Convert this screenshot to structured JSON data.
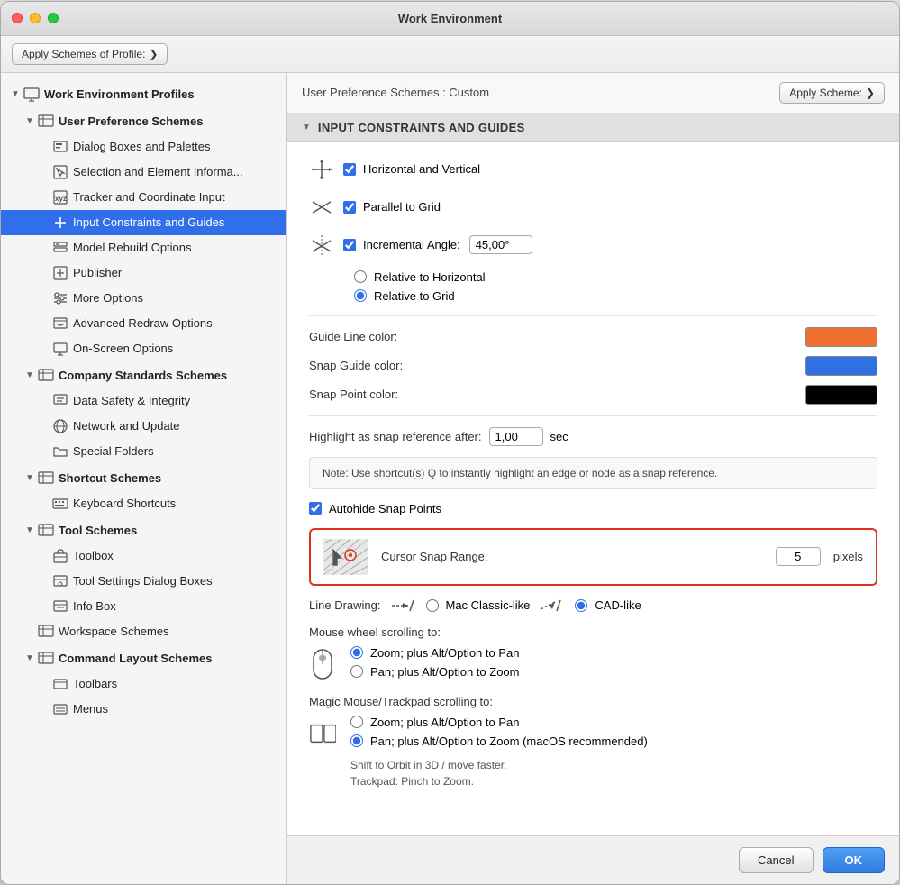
{
  "window": {
    "title": "Work Environment"
  },
  "toolbar": {
    "apply_schemes_label": "Apply Schemes of Profile:",
    "apply_schemes_chevron": "❯"
  },
  "content_header": {
    "title": "User Preference Schemes :  Custom",
    "apply_scheme_label": "Apply Scheme:",
    "apply_scheme_chevron": "❯"
  },
  "sidebar": {
    "items": [
      {
        "id": "work-env-profiles",
        "label": "Work Environment Profiles",
        "level": 0,
        "hasArrow": true,
        "arrowState": "down",
        "iconType": "monitor"
      },
      {
        "id": "user-pref-schemes",
        "label": "User Preference Schemes",
        "level": 1,
        "hasArrow": true,
        "arrowState": "down",
        "iconType": "person-grid"
      },
      {
        "id": "dialog-boxes",
        "label": "Dialog Boxes and Palettes",
        "level": 2,
        "hasArrow": false,
        "iconType": "dialog"
      },
      {
        "id": "selection-element",
        "label": "Selection and Element Informa...",
        "level": 2,
        "hasArrow": false,
        "iconType": "cursor"
      },
      {
        "id": "tracker-coord",
        "label": "Tracker and Coordinate Input",
        "level": 2,
        "hasArrow": false,
        "iconType": "xyz"
      },
      {
        "id": "input-constraints",
        "label": "Input Constraints and Guides",
        "level": 2,
        "hasArrow": false,
        "iconType": "constraint",
        "active": true
      },
      {
        "id": "model-rebuild",
        "label": "Model Rebuild Options",
        "level": 2,
        "hasArrow": false,
        "iconType": "rebuild"
      },
      {
        "id": "publisher",
        "label": "Publisher",
        "level": 2,
        "hasArrow": false,
        "iconType": "publish"
      },
      {
        "id": "more-options",
        "label": "More Options",
        "level": 2,
        "hasArrow": false,
        "iconType": "sliders"
      },
      {
        "id": "advanced-redraw",
        "label": "Advanced Redraw Options",
        "level": 2,
        "hasArrow": false,
        "iconType": "redraw"
      },
      {
        "id": "on-screen",
        "label": "On-Screen Options",
        "level": 2,
        "hasArrow": false,
        "iconType": "screen"
      },
      {
        "id": "company-standards",
        "label": "Company Standards Schemes",
        "level": 1,
        "hasArrow": true,
        "arrowState": "down",
        "iconType": "company"
      },
      {
        "id": "data-safety",
        "label": "Data Safety & Integrity",
        "level": 2,
        "hasArrow": false,
        "iconType": "shield"
      },
      {
        "id": "network-update",
        "label": "Network and Update",
        "level": 2,
        "hasArrow": false,
        "iconType": "network"
      },
      {
        "id": "special-folders",
        "label": "Special Folders",
        "level": 2,
        "hasArrow": false,
        "iconType": "folder"
      },
      {
        "id": "shortcut-schemes",
        "label": "Shortcut Schemes",
        "level": 1,
        "hasArrow": true,
        "arrowState": "down",
        "iconType": "shortcut"
      },
      {
        "id": "keyboard-shortcuts",
        "label": "Keyboard Shortcuts",
        "level": 2,
        "hasArrow": false,
        "iconType": "keyboard"
      },
      {
        "id": "tool-schemes",
        "label": "Tool Schemes",
        "level": 1,
        "hasArrow": true,
        "arrowState": "down",
        "iconType": "tool"
      },
      {
        "id": "toolbox",
        "label": "Toolbox",
        "level": 2,
        "hasArrow": false,
        "iconType": "toolbox"
      },
      {
        "id": "tool-settings",
        "label": "Tool Settings Dialog Boxes",
        "level": 2,
        "hasArrow": false,
        "iconType": "tool-settings"
      },
      {
        "id": "info-box",
        "label": "Info Box",
        "level": 2,
        "hasArrow": false,
        "iconType": "info"
      },
      {
        "id": "workspace-schemes",
        "label": "Workspace Schemes",
        "level": 1,
        "hasArrow": false,
        "iconType": "workspace"
      },
      {
        "id": "command-layout",
        "label": "Command Layout Schemes",
        "level": 1,
        "hasArrow": true,
        "arrowState": "down",
        "iconType": "layout"
      },
      {
        "id": "toolbars",
        "label": "Toolbars",
        "level": 2,
        "hasArrow": false,
        "iconType": "toolbar"
      },
      {
        "id": "menus",
        "label": "Menus",
        "level": 2,
        "hasArrow": false,
        "iconType": "menus"
      }
    ]
  },
  "section": {
    "title": "INPUT CONSTRAINTS AND GUIDES",
    "checkboxes": {
      "horizontal_vertical": {
        "label": "Horizontal and Vertical",
        "checked": true
      },
      "parallel_to_grid": {
        "label": "Parallel to Grid",
        "checked": true
      },
      "incremental_angle": {
        "label": "Incremental Angle:",
        "checked": true
      }
    },
    "angle_value": "45,00°",
    "radios": {
      "relative_horizontal": {
        "label": "Relative to Horizontal",
        "checked": false
      },
      "relative_grid": {
        "label": "Relative to Grid",
        "checked": true
      }
    },
    "colors": {
      "guide_line": {
        "label": "Guide Line color:",
        "value": "#f07030"
      },
      "snap_guide": {
        "label": "Snap Guide color:",
        "value": "#3070e0"
      },
      "snap_point": {
        "label": "Snap Point color:",
        "value": "#000000"
      }
    },
    "highlight": {
      "label": "Highlight as snap reference after:",
      "value": "1,00",
      "unit": "sec"
    },
    "note": "Note: Use shortcut(s) Q to instantly highlight an edge or node as a snap reference.",
    "autohide": {
      "label": "Autohide Snap Points",
      "checked": true
    },
    "cursor_snap": {
      "label": "Cursor Snap Range:",
      "value": "5",
      "unit": "pixels"
    },
    "line_drawing": {
      "label": "Line Drawing:",
      "mac_classic": {
        "label": "Mac Classic-like",
        "checked": false
      },
      "cad_like": {
        "label": "CAD-like",
        "checked": true
      }
    },
    "mouse_wheel": {
      "label": "Mouse wheel scrolling to:",
      "zoom_pan": {
        "label": "Zoom; plus Alt/Option to Pan",
        "checked": true
      },
      "pan_zoom": {
        "label": "Pan; plus Alt/Option to Zoom",
        "checked": false
      }
    },
    "magic_mouse": {
      "label": "Magic Mouse/Trackpad scrolling to:",
      "zoom_pan": {
        "label": "Zoom; plus Alt/Option to Pan",
        "checked": false
      },
      "pan_zoom": {
        "label": "Pan; plus Alt/Option to Zoom (macOS recommended)",
        "checked": true
      },
      "trackpad_note_1": "Shift to Orbit in 3D / move faster.",
      "trackpad_note_2": "Trackpad: Pinch to Zoom."
    }
  },
  "footer": {
    "cancel_label": "Cancel",
    "ok_label": "OK"
  }
}
